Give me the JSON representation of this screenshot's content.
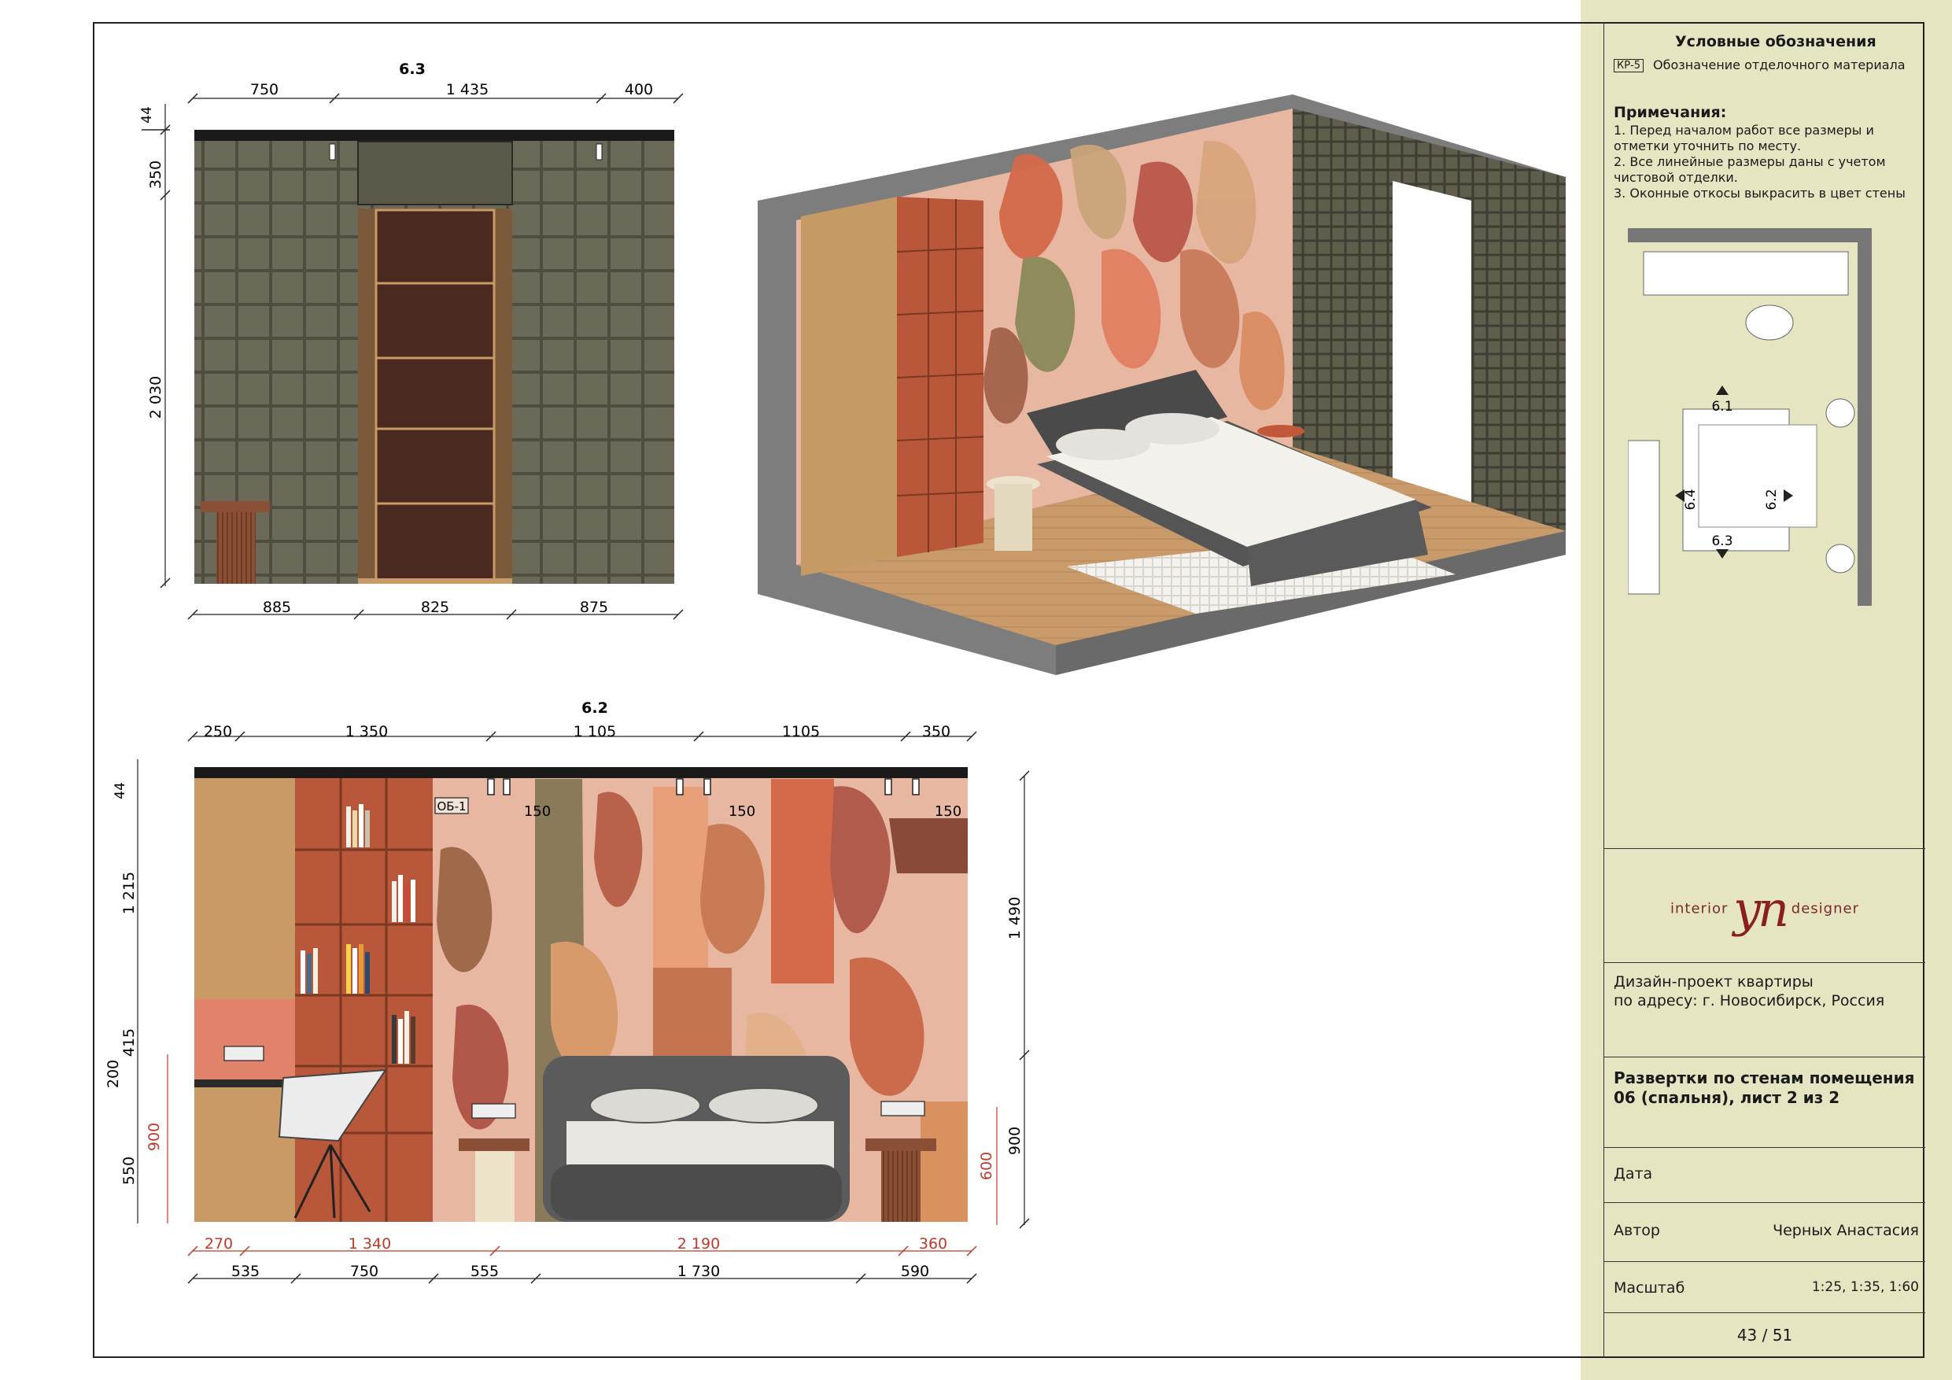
{
  "legend": {
    "title": "Условные обозначения",
    "code": "КР-5",
    "code_desc": "Обозначение отделочного материала"
  },
  "notes": {
    "heading": "Примечания:",
    "lines": [
      "1. Перед началом работ все размеры и",
      "отметки уточнить по месту.",
      "2. Все линейные размеры даны с учетом",
      "чистовой отделки.",
      "3. Оконные откосы выкрасить в цвет стены"
    ]
  },
  "plan_markers": [
    "6.1",
    "6.2",
    "6.3",
    "6.4"
  ],
  "brand": {
    "left": "interior",
    "mark": "yn",
    "right": "designer"
  },
  "project": [
    "Дизайн-проект квартиры",
    "по адресу: г. Новосибирск, Россия"
  ],
  "sheet_title": [
    "Развертки по стенам помещения",
    "06 (спальня), лист 2 из 2"
  ],
  "date_label": "Дата",
  "author_label": "Автор",
  "author_value": "Черных Анастасия",
  "scale_label": "Масштаб",
  "scale_value": "1:25, 1:35, 1:60",
  "page": "43 / 51",
  "view_63": {
    "title": "6.3",
    "top_dims": [
      "750",
      "1 435",
      "400"
    ],
    "bottom_dims": [
      "885",
      "825",
      "875"
    ],
    "left_dims": [
      "44",
      "350",
      "2 030"
    ]
  },
  "view_62": {
    "title": "6.2",
    "top_dims": [
      "250",
      "1 350",
      "1 105",
      "1105",
      "350"
    ],
    "left_dims": [
      "44",
      "1 215",
      "415",
      "200",
      "900",
      "550"
    ],
    "right_dims": [
      "1 490",
      "900",
      "600"
    ],
    "light_dims": [
      "150",
      "150",
      "150"
    ],
    "tag": "ОБ-1",
    "bottom_red_dims": [
      "270",
      "1 340",
      "2 190",
      "360"
    ],
    "bottom_dims": [
      "535",
      "750",
      "555",
      "1 730",
      "590"
    ]
  },
  "colors": {
    "sidebar": "#e6e5c1",
    "tile_wall": "#6b6a58",
    "door": "#4a2a20",
    "wood": "#c89a66",
    "shelf": "#b8573a",
    "red_dim": "#c0392b"
  }
}
